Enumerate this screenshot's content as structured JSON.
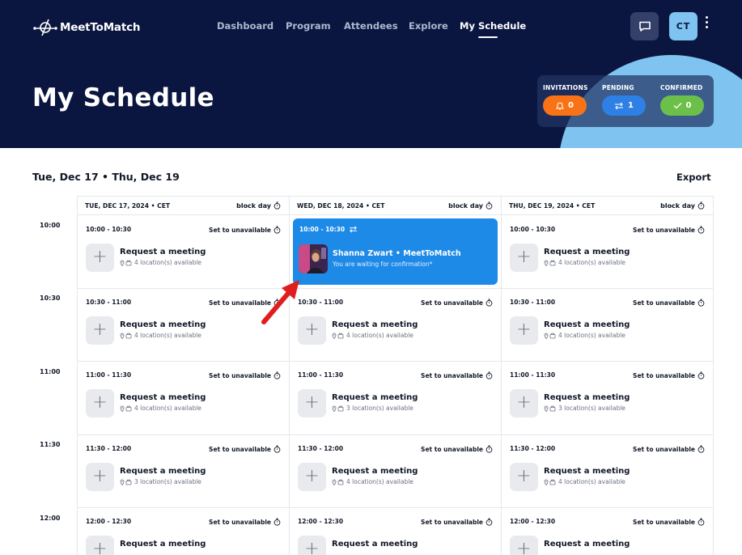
{
  "app": {
    "name": "MeetToMatch"
  },
  "nav": {
    "items": [
      {
        "label": "Dashboard",
        "active": false
      },
      {
        "label": "Program",
        "active": false
      },
      {
        "label": "Attendees",
        "active": false
      },
      {
        "label": "Explore",
        "active": false
      },
      {
        "label": "My Schedule",
        "active": true
      }
    ]
  },
  "header": {
    "chat_icon": "chat-bubble-icon",
    "avatar_initials": "CT",
    "menu_icon": "kebab-menu-icon",
    "page_title": "My Schedule",
    "status": [
      {
        "label": "INVITATIONS",
        "icon": "bell-icon",
        "count": "0",
        "color": "#f97316"
      },
      {
        "label": "PENDING",
        "icon": "swap-arrows-icon",
        "count": "1",
        "color": "#2f80e6"
      },
      {
        "label": "CONFIRMED",
        "icon": "check-icon",
        "count": "0",
        "color": "#6cc04a"
      }
    ]
  },
  "toolbar": {
    "date_range": "Tue, Dec 17 • Thu, Dec 19",
    "export_label": "Export"
  },
  "schedule": {
    "days": [
      {
        "label": "TUE, DEC 17, 2024 • CET",
        "block_label": "block day"
      },
      {
        "label": "WED, DEC 18, 2024 • CET",
        "block_label": "block day"
      },
      {
        "label": "THU, DEC 19, 2024 • CET",
        "block_label": "block day"
      }
    ],
    "time_labels": [
      "10:00",
      "10:30",
      "11:00",
      "11:30",
      "12:00"
    ],
    "unavailable_label": "Set to unavailable",
    "request_label": "Request a meeting",
    "slots": [
      [
        {
          "time": "10:00 - 10:30",
          "locations": "4 location(s) available"
        },
        {
          "time": "10:30 - 11:00",
          "locations": "4 location(s) available"
        },
        {
          "time": "11:00 - 11:30",
          "locations": "4 location(s) available"
        },
        {
          "time": "11:30 - 12:00",
          "locations": "3 location(s) available"
        },
        {
          "time": "12:00 - 12:30",
          "locations": ""
        }
      ],
      [
        {
          "time": "10:00 - 10:30",
          "locations": "",
          "meeting": true
        },
        {
          "time": "10:30 - 11:00",
          "locations": "4 location(s) available"
        },
        {
          "time": "11:00 - 11:30",
          "locations": "3 location(s) available"
        },
        {
          "time": "11:30 - 12:00",
          "locations": "4 location(s) available"
        },
        {
          "time": "12:00 - 12:30",
          "locations": ""
        }
      ],
      [
        {
          "time": "10:00 - 10:30",
          "locations": "4 location(s) available"
        },
        {
          "time": "10:30 - 11:00",
          "locations": "4 location(s) available"
        },
        {
          "time": "11:00 - 11:30",
          "locations": "3 location(s) available"
        },
        {
          "time": "11:30 - 12:00",
          "locations": "4 location(s) available"
        },
        {
          "time": "12:00 - 12:30",
          "locations": ""
        }
      ]
    ],
    "meeting": {
      "time": "10:00 - 10:30",
      "name": "Shanna Zwart • MeetToMatch",
      "status": "You are waiting for confirmation*"
    }
  },
  "colors": {
    "header_bg": "#0b1640",
    "accent_light_blue": "#7fc4f0",
    "meeting_card": "#1e8ae8",
    "annotation_arrow": "#e11d1d"
  }
}
